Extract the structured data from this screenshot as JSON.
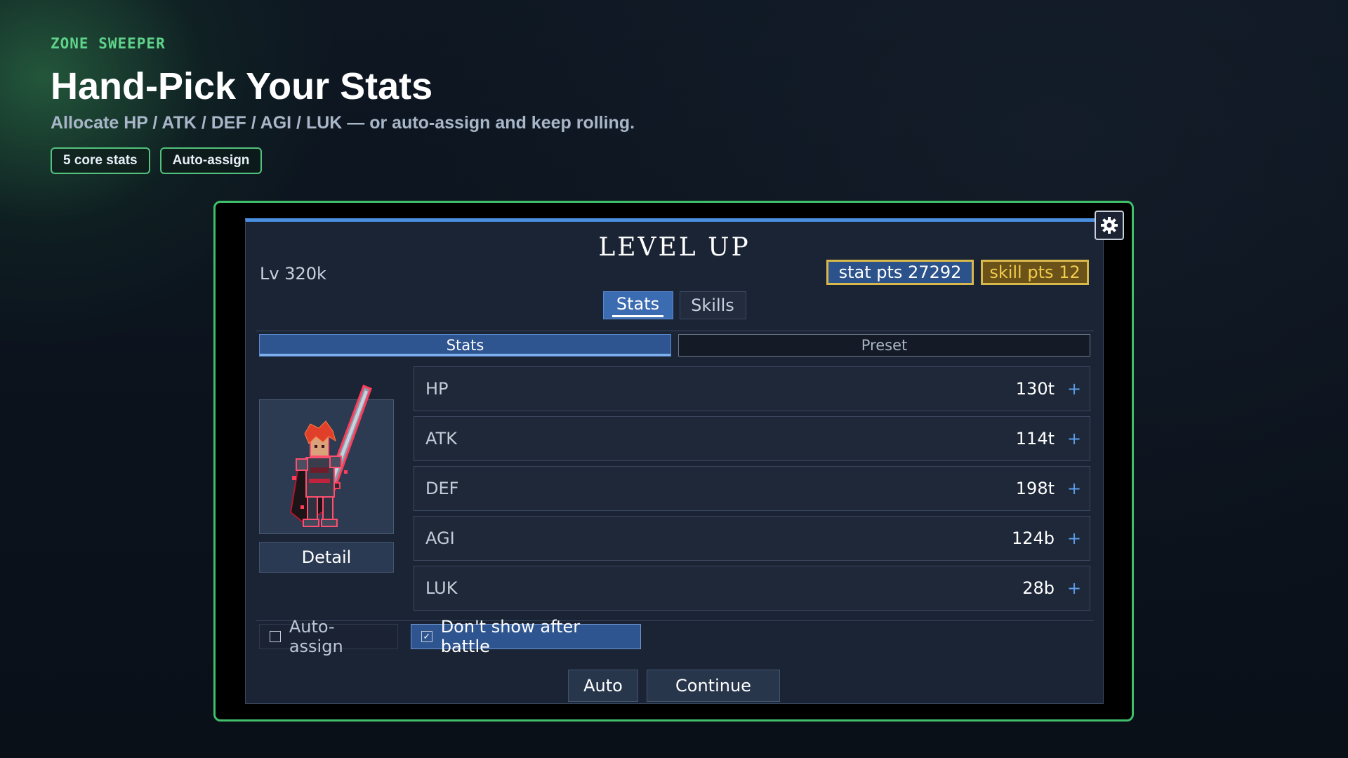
{
  "header": {
    "eyebrow": "ZONE SWEEPER",
    "title": "Hand-Pick Your Stats",
    "subtitle": "Allocate HP / ATK / DEF / AGI / LUK — or auto-assign and keep rolling.",
    "chips": [
      "5 core stats",
      "Auto-assign"
    ]
  },
  "dialog": {
    "title": "LEVEL UP",
    "level": "Lv 320k",
    "stat_points": "stat pts 27292",
    "skill_points": "skill pts 12",
    "tabs": [
      "Stats",
      "Skills"
    ],
    "active_tab": "Stats",
    "subtabs": [
      "Stats",
      "Preset"
    ],
    "active_subtab": "Stats",
    "detail_label": "Detail",
    "stats": [
      {
        "name": "HP",
        "value": "130t"
      },
      {
        "name": "ATK",
        "value": "114t"
      },
      {
        "name": "DEF",
        "value": "198t"
      },
      {
        "name": "AGI",
        "value": "124b"
      },
      {
        "name": "LUK",
        "value": "28b"
      }
    ],
    "plus_symbol": "+",
    "auto_assign": {
      "label": "Auto-assign",
      "checked": false
    },
    "dont_show": {
      "label": "Don't show after battle",
      "checked": true
    },
    "check_mark": "✓",
    "buttons": {
      "auto": "Auto",
      "continue": "Continue"
    }
  },
  "icons": {
    "settings": "gear-icon",
    "portrait": "knight-sprite"
  },
  "colors": {
    "accent": "#4a8fe0",
    "frame": "#3fbf6a",
    "gold": "#d8b84a",
    "eyebrow": "#5fd38a"
  }
}
